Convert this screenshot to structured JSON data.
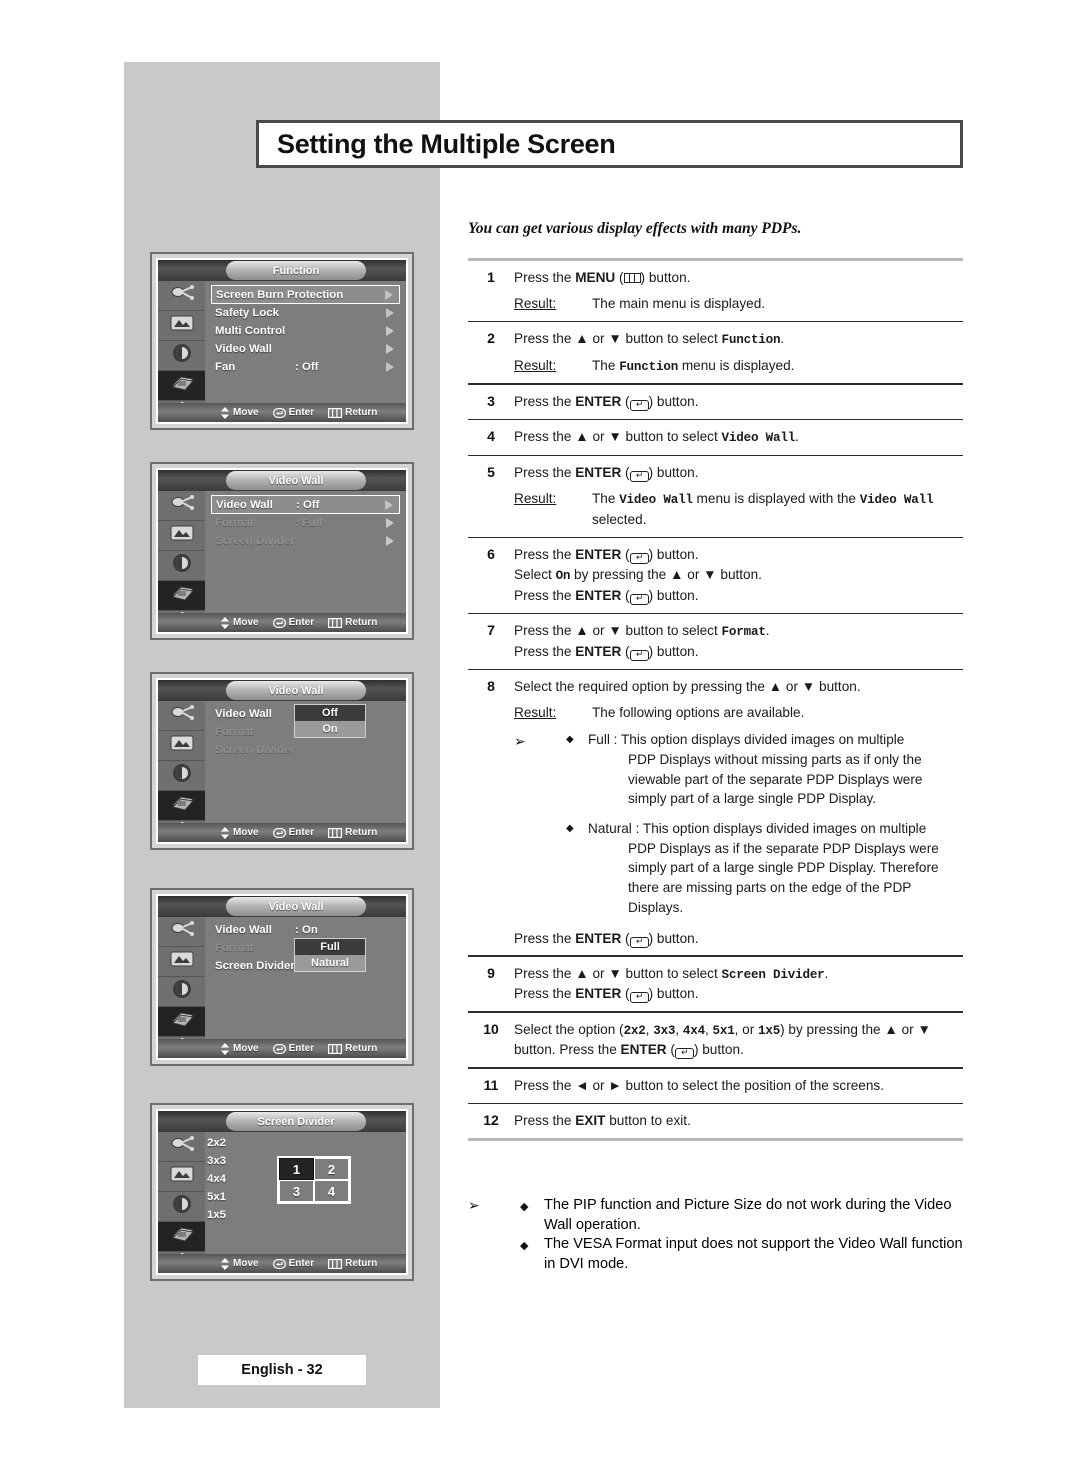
{
  "page": {
    "title": "Setting the Multiple Screen",
    "intro": "You can get various display effects with many PDPs.",
    "footer": "English - 32"
  },
  "osd_common": {
    "move": "Move",
    "enter": "Enter",
    "return": "Return",
    "icons": [
      "input-source-icon",
      "picture-icon",
      "sound-icon",
      "function-icon",
      "setup-gear-icon"
    ]
  },
  "menus": [
    {
      "name": "function-menu",
      "title": "Function",
      "active_rail_index": 3,
      "rows": [
        {
          "label": "Screen Burn Protection",
          "value": "",
          "selected": true,
          "dim": false,
          "arrow": "hollow"
        },
        {
          "label": "Safety Lock",
          "value": "",
          "selected": false,
          "dim": false,
          "arrow": "hollow"
        },
        {
          "label": "Multi Control",
          "value": "",
          "selected": false,
          "dim": false,
          "arrow": "solid"
        },
        {
          "label": "Video Wall",
          "value": "",
          "selected": false,
          "dim": false,
          "arrow": "solid"
        },
        {
          "label": "Fan",
          "value": ": Off",
          "selected": false,
          "dim": false,
          "arrow": "hollow"
        }
      ]
    },
    {
      "name": "video-wall-menu-off",
      "title": "Video Wall",
      "active_rail_index": 3,
      "rows": [
        {
          "label": "Video Wall",
          "value": ": Off",
          "selected": true,
          "dim": false,
          "arrow": "hollow"
        },
        {
          "label": "Format",
          "value": ": Full",
          "selected": false,
          "dim": true,
          "arrow": "solid"
        },
        {
          "label": "Screen Divider",
          "value": "",
          "selected": false,
          "dim": true,
          "arrow": "solid"
        }
      ]
    },
    {
      "name": "video-wall-menu-onoff-popup",
      "title": "Video Wall",
      "active_rail_index": 3,
      "rows": [
        {
          "label": "Video Wall",
          "value": ":",
          "selected": false,
          "dim": false,
          "arrow": "none"
        },
        {
          "label": "Format",
          "value": ":",
          "selected": false,
          "dim": true,
          "arrow": "none"
        },
        {
          "label": "Screen Divider",
          "value": "",
          "selected": false,
          "dim": true,
          "arrow": "none"
        }
      ],
      "popup": {
        "options": [
          "Off",
          "On"
        ],
        "highlighted": "Off"
      }
    },
    {
      "name": "video-wall-menu-format-popup",
      "title": "Video Wall",
      "active_rail_index": 3,
      "rows": [
        {
          "label": "Video Wall",
          "value": ": On",
          "selected": false,
          "dim": false,
          "arrow": "none"
        },
        {
          "label": "Format",
          "value": ":",
          "selected": false,
          "dim": true,
          "arrow": "none"
        },
        {
          "label": "Screen Divider",
          "value": "",
          "selected": false,
          "dim": false,
          "arrow": "none"
        }
      ],
      "popup": {
        "options": [
          "Full",
          "Natural"
        ],
        "highlighted": "Full"
      }
    },
    {
      "name": "screen-divider-menu",
      "title": "Screen Divider",
      "active_rail_index": 3,
      "options": [
        "2x2",
        "3x3",
        "4x4",
        "5x1",
        "1x5"
      ],
      "grid": {
        "cells": [
          "1",
          "2",
          "3",
          "4"
        ],
        "highlighted": "1"
      }
    }
  ],
  "steps": [
    {
      "num": "1",
      "lines": [
        {
          "parts": [
            {
              "t": "Press the "
            },
            {
              "t": "MENU",
              "s": "bold"
            },
            {
              "t": " ("
            },
            {
              "t": "",
              "s": "key-menu"
            },
            {
              "t": ") button."
            }
          ]
        }
      ],
      "result": {
        "label": "Result:",
        "parts": [
          {
            "t": "The main menu is displayed."
          }
        ]
      }
    },
    {
      "num": "2",
      "lines": [
        {
          "parts": [
            {
              "t": "Press the "
            },
            {
              "t": "▲",
              "s": "bold"
            },
            {
              "t": " or "
            },
            {
              "t": "▼",
              "s": "bold"
            },
            {
              "t": " button to select "
            },
            {
              "t": "Function",
              "s": "mono"
            },
            {
              "t": "."
            }
          ]
        }
      ],
      "result": {
        "label": "Result:",
        "parts": [
          {
            "t": "The "
          },
          {
            "t": "Function",
            "s": "mono"
          },
          {
            "t": " menu is displayed."
          }
        ]
      }
    },
    {
      "num": "3",
      "lines": [
        {
          "parts": [
            {
              "t": "Press the "
            },
            {
              "t": "ENTER",
              "s": "bold"
            },
            {
              "t": " ("
            },
            {
              "t": "",
              "s": "key-enter"
            },
            {
              "t": ") button."
            }
          ]
        }
      ]
    },
    {
      "num": "4",
      "lines": [
        {
          "parts": [
            {
              "t": "Press the "
            },
            {
              "t": "▲",
              "s": "bold"
            },
            {
              "t": " or "
            },
            {
              "t": "▼",
              "s": "bold"
            },
            {
              "t": " button to select "
            },
            {
              "t": "Video Wall",
              "s": "mono"
            },
            {
              "t": "."
            }
          ]
        }
      ]
    },
    {
      "num": "5",
      "lines": [
        {
          "parts": [
            {
              "t": "Press the "
            },
            {
              "t": "ENTER",
              "s": "bold"
            },
            {
              "t": " ("
            },
            {
              "t": "",
              "s": "key-enter"
            },
            {
              "t": ") button."
            }
          ]
        }
      ],
      "result": {
        "label": "Result:",
        "parts": [
          {
            "t": "The "
          },
          {
            "t": "Video Wall",
            "s": "mono"
          },
          {
            "t": " menu is displayed with the "
          },
          {
            "t": "Video Wall",
            "s": "mono"
          },
          {
            "t": " selected."
          }
        ]
      }
    },
    {
      "num": "6",
      "lines": [
        {
          "parts": [
            {
              "t": "Press the "
            },
            {
              "t": "ENTER",
              "s": "bold"
            },
            {
              "t": " ("
            },
            {
              "t": "",
              "s": "key-enter"
            },
            {
              "t": ") button."
            }
          ]
        },
        {
          "parts": [
            {
              "t": "Select "
            },
            {
              "t": "On",
              "s": "mono"
            },
            {
              "t": " by pressing the "
            },
            {
              "t": "▲",
              "s": "bold"
            },
            {
              "t": " or "
            },
            {
              "t": "▼",
              "s": "bold"
            },
            {
              "t": " button."
            }
          ]
        },
        {
          "parts": [
            {
              "t": "Press the "
            },
            {
              "t": "ENTER",
              "s": "bold"
            },
            {
              "t": " ("
            },
            {
              "t": "",
              "s": "key-enter"
            },
            {
              "t": ") button."
            }
          ]
        }
      ]
    },
    {
      "num": "7",
      "lines": [
        {
          "parts": [
            {
              "t": "Press the "
            },
            {
              "t": "▲",
              "s": "bold"
            },
            {
              "t": " or "
            },
            {
              "t": "▼",
              "s": "bold"
            },
            {
              "t": " button to select "
            },
            {
              "t": "Format",
              "s": "mono"
            },
            {
              "t": "."
            }
          ]
        },
        {
          "parts": [
            {
              "t": "Press the "
            },
            {
              "t": "ENTER",
              "s": "bold"
            },
            {
              "t": " ("
            },
            {
              "t": "",
              "s": "key-enter"
            },
            {
              "t": ") button."
            }
          ]
        }
      ]
    },
    {
      "num": "8",
      "lines": [
        {
          "parts": [
            {
              "t": "Select the required option by pressing the "
            },
            {
              "t": "▲",
              "s": "bold"
            },
            {
              "t": " or "
            },
            {
              "t": "▼",
              "s": "bold"
            },
            {
              "t": " button."
            }
          ]
        }
      ],
      "result": {
        "label": "Result:",
        "parts": [
          {
            "t": "The following options are available."
          }
        ]
      },
      "bullets": [
        {
          "arrow": true,
          "head": "Full : This option displays divided images on multiple",
          "body": "PDP Displays without missing parts as if only the viewable part of the separate PDP Displays were simply part of a large single PDP Display."
        },
        {
          "arrow": false,
          "head": "Natural : This option displays divided images on multiple",
          "body": "PDP Displays as if the separate PDP Displays were simply part of a large single PDP Display. Therefore  there are missing parts on the edge of the PDP Displays."
        }
      ],
      "trailing": {
        "parts": [
          {
            "t": "Press the "
          },
          {
            "t": "ENTER",
            "s": "bold"
          },
          {
            "t": " ("
          },
          {
            "t": "",
            "s": "key-enter"
          },
          {
            "t": ") button."
          }
        ]
      }
    },
    {
      "num": "9",
      "lines": [
        {
          "parts": [
            {
              "t": "Press the "
            },
            {
              "t": "▲",
              "s": "bold"
            },
            {
              "t": " or "
            },
            {
              "t": "▼",
              "s": "bold"
            },
            {
              "t": " button to select "
            },
            {
              "t": "Screen Divider",
              "s": "mono"
            },
            {
              "t": "."
            }
          ]
        },
        {
          "parts": [
            {
              "t": "Press the "
            },
            {
              "t": "ENTER",
              "s": "bold"
            },
            {
              "t": " ("
            },
            {
              "t": "",
              "s": "key-enter"
            },
            {
              "t": ") button."
            }
          ]
        }
      ]
    },
    {
      "num": "10",
      "lines": [
        {
          "parts": [
            {
              "t": "Select the option ("
            },
            {
              "t": "2x2",
              "s": "mono"
            },
            {
              "t": ", "
            },
            {
              "t": "3x3",
              "s": "mono"
            },
            {
              "t": ", "
            },
            {
              "t": "4x4",
              "s": "mono"
            },
            {
              "t": ", "
            },
            {
              "t": "5x1",
              "s": "mono"
            },
            {
              "t": ", or "
            },
            {
              "t": "1x5",
              "s": "mono"
            },
            {
              "t": ") by pressing the "
            },
            {
              "t": "▲",
              "s": "bold"
            },
            {
              "t": " or "
            },
            {
              "t": "▼",
              "s": "bold"
            },
            {
              "t": " button. Press the "
            },
            {
              "t": "ENTER",
              "s": "bold"
            },
            {
              "t": " ("
            },
            {
              "t": "",
              "s": "key-enter"
            },
            {
              "t": ") button."
            }
          ]
        }
      ]
    },
    {
      "num": "11",
      "lines": [
        {
          "parts": [
            {
              "t": "Press the "
            },
            {
              "t": "◄",
              "s": "bold"
            },
            {
              "t": " or "
            },
            {
              "t": "►",
              "s": "bold"
            },
            {
              "t": " button to select the position of the screens."
            }
          ]
        }
      ]
    },
    {
      "num": "12",
      "lines": [
        {
          "parts": [
            {
              "t": "Press the "
            },
            {
              "t": "EXIT",
              "s": "bold"
            },
            {
              "t": " button to exit."
            }
          ]
        }
      ]
    }
  ],
  "notes": [
    {
      "arrow": true,
      "text": "The PIP function and Picture Size do not work during the Video Wall operation."
    },
    {
      "arrow": false,
      "text": "The VESA Format input does not support the Video Wall function in DVI mode."
    }
  ]
}
